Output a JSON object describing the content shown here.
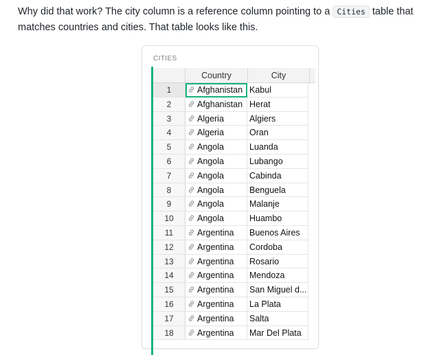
{
  "intro": {
    "before": "Why did that work? The city column is a reference column pointing to a ",
    "code": "Cities",
    "after": " table that matches countries and cities. That table looks like this."
  },
  "card": {
    "title": "CITIES"
  },
  "columns": {
    "country": "Country",
    "city": "City"
  },
  "icons": {
    "reference": "link-icon",
    "accent_color": "#16b378"
  },
  "rows": [
    {
      "n": "1",
      "country": "Afghanistan",
      "city": "Kabul"
    },
    {
      "n": "2",
      "country": "Afghanistan",
      "city": "Herat"
    },
    {
      "n": "3",
      "country": "Algeria",
      "city": "Algiers"
    },
    {
      "n": "4",
      "country": "Algeria",
      "city": "Oran"
    },
    {
      "n": "5",
      "country": "Angola",
      "city": "Luanda"
    },
    {
      "n": "6",
      "country": "Angola",
      "city": "Lubango"
    },
    {
      "n": "7",
      "country": "Angola",
      "city": "Cabinda"
    },
    {
      "n": "8",
      "country": "Angola",
      "city": "Benguela"
    },
    {
      "n": "9",
      "country": "Angola",
      "city": "Malanje"
    },
    {
      "n": "10",
      "country": "Angola",
      "city": "Huambo"
    },
    {
      "n": "11",
      "country": "Argentina",
      "city": "Buenos Aires"
    },
    {
      "n": "12",
      "country": "Argentina",
      "city": "Cordoba"
    },
    {
      "n": "13",
      "country": "Argentina",
      "city": "Rosario"
    },
    {
      "n": "14",
      "country": "Argentina",
      "city": "Mendoza"
    },
    {
      "n": "15",
      "country": "Argentina",
      "city": "San Miguel d..."
    },
    {
      "n": "16",
      "country": "Argentina",
      "city": "La Plata"
    },
    {
      "n": "17",
      "country": "Argentina",
      "city": "Salta"
    },
    {
      "n": "18",
      "country": "Argentina",
      "city": "Mar Del Plata"
    }
  ]
}
